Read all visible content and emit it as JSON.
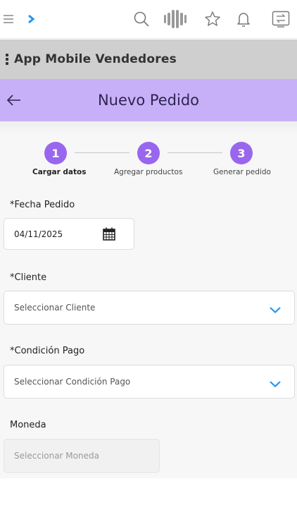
{
  "topbar": {
    "icons": [
      "menu-icon",
      "chevron-right-icon",
      "search-icon",
      "logo-icon",
      "star-icon",
      "bell-icon",
      "swap-icon"
    ],
    "accent": "#2196f3"
  },
  "appbar": {
    "title": "App Mobile Vendedores"
  },
  "header": {
    "title": "Nuevo Pedido",
    "color": "#c8b0f8"
  },
  "stepper": {
    "steps": [
      {
        "number": "1",
        "label": "Cargar datos",
        "active": true
      },
      {
        "number": "2",
        "label": "Agregar productos",
        "active": false
      },
      {
        "number": "3",
        "label": "Generar pedido",
        "active": false
      }
    ],
    "color": "#9966ee"
  },
  "form": {
    "fecha": {
      "label": "*Fecha Pedido",
      "value": "04/11/2025"
    },
    "cliente": {
      "label": "*Cliente",
      "placeholder": "Seleccionar Cliente"
    },
    "condicion": {
      "label": "*Condición Pago",
      "placeholder": "Seleccionar Condición Pago"
    },
    "moneda": {
      "label": "Moneda",
      "placeholder": "Seleccionar Moneda",
      "disabled": true
    }
  }
}
